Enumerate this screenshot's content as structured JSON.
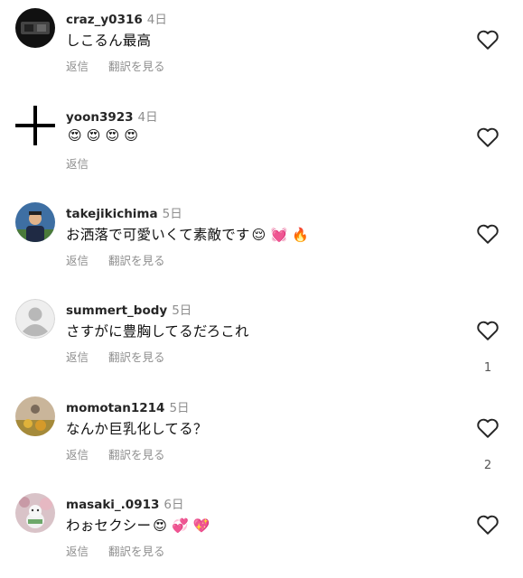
{
  "comments": [
    {
      "username": "craz_y0316",
      "time": "4日",
      "text": "しこるん最高",
      "emoji": "",
      "reply": "返信",
      "translate": "翻訳を見る",
      "likes": ""
    },
    {
      "username": "yoon3923",
      "time": "4日",
      "text": "",
      "emoji": "😍 😍 😍 😍",
      "reply": "返信",
      "translate": "",
      "likes": ""
    },
    {
      "username": "takejikichima",
      "time": "5日",
      "text": "お洒落で可愛いくて素敵です",
      "emoji": "😌 💓 🔥",
      "reply": "返信",
      "translate": "翻訳を見る",
      "likes": ""
    },
    {
      "username": "summert_body",
      "time": "5日",
      "text": "さすがに豊胸してるだろこれ",
      "emoji": "",
      "reply": "返信",
      "translate": "翻訳を見る",
      "likes": "1"
    },
    {
      "username": "momotan1214",
      "time": "5日",
      "text": "なんか巨乳化してる？",
      "emoji": "",
      "reply": "返信",
      "translate": "翻訳を見る",
      "likes": "2"
    },
    {
      "username": "masaki_.0913",
      "time": "6日",
      "text": "わぉセクシー",
      "emoji": "😍 💞 💖",
      "reply": "返信",
      "translate": "翻訳を見る",
      "likes": ""
    }
  ],
  "icons": {
    "like": "heart-outline-icon"
  },
  "colors": {
    "username": "#262626",
    "meta": "#8e8e8e",
    "text": "#111111"
  }
}
